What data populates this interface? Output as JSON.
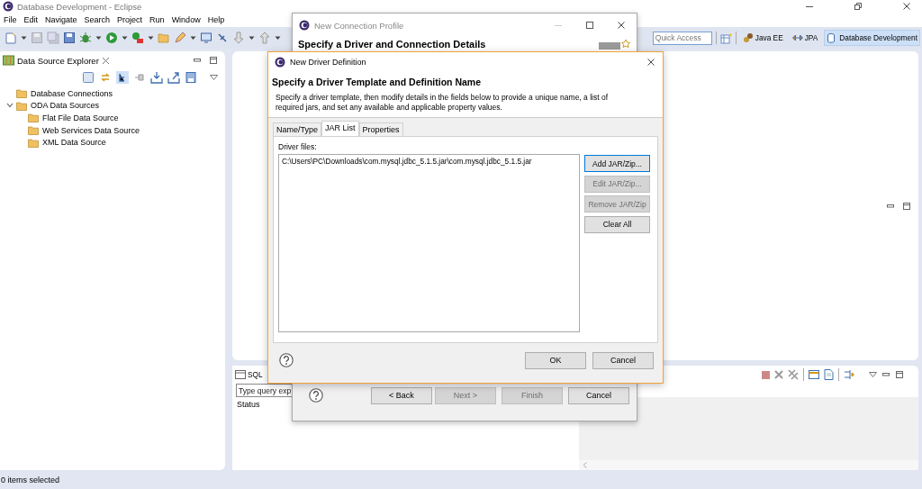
{
  "window": {
    "title": "Database Development - Eclipse"
  },
  "menu": [
    "File",
    "Edit",
    "Navigate",
    "Search",
    "Project",
    "Run",
    "Window",
    "Help"
  ],
  "toolbar": {
    "quick_access": {
      "placeholder": "Quick Access"
    },
    "perspectives": [
      {
        "label": "Java EE",
        "selected": false
      },
      {
        "label": "JPA",
        "selected": false
      },
      {
        "label": "Database Development",
        "selected": true
      }
    ]
  },
  "explorer": {
    "title": "Data Source Explorer",
    "tree": [
      {
        "label": "Database Connections"
      },
      {
        "label": "ODA Data Sources",
        "expanded": true,
        "children": [
          {
            "label": "Flat File Data Source"
          },
          {
            "label": "Web Services Data Source"
          },
          {
            "label": "XML Data Source"
          }
        ]
      }
    ]
  },
  "sql_results": {
    "tab": "SQL",
    "query_field": {
      "placeholder": "Type query exp"
    },
    "column": "Status"
  },
  "connection_dialog": {
    "title": "New Connection Profile",
    "heading": "Specify a Driver and Connection Details",
    "buttons": [
      {
        "label": "< Back",
        "disabled": false
      },
      {
        "label": "Next >",
        "disabled": true
      },
      {
        "label": "Finish",
        "disabled": true
      },
      {
        "label": "Cancel",
        "disabled": false
      }
    ]
  },
  "driver_dialog": {
    "title": "New Driver Definition",
    "heading": "Specify a Driver Template and Definition Name",
    "description": "Specify a driver template, then modify details in the fields below to provide a unique name, a list of required jars, and set any available and applicable property values.",
    "tabs": [
      {
        "label": "Name/Type",
        "selected": false
      },
      {
        "label": "JAR List",
        "selected": true
      },
      {
        "label": "Properties",
        "selected": false
      }
    ],
    "files_label": "Driver files:",
    "files": [
      "C:\\Users\\PC\\Downloads\\com.mysql.jdbc_5.1.5.jar\\com.mysql.jdbc_5.1.5.jar"
    ],
    "side_buttons": [
      {
        "label": "Add JAR/Zip...",
        "disabled": false,
        "focused": true
      },
      {
        "label": "Edit JAR/Zip...",
        "disabled": true,
        "focused": false
      },
      {
        "label": "Remove JAR/Zip",
        "disabled": true,
        "focused": false
      },
      {
        "label": "Clear All",
        "disabled": false,
        "focused": false
      }
    ],
    "buttons": [
      "OK",
      "Cancel"
    ]
  },
  "status_bar": "0 items selected"
}
